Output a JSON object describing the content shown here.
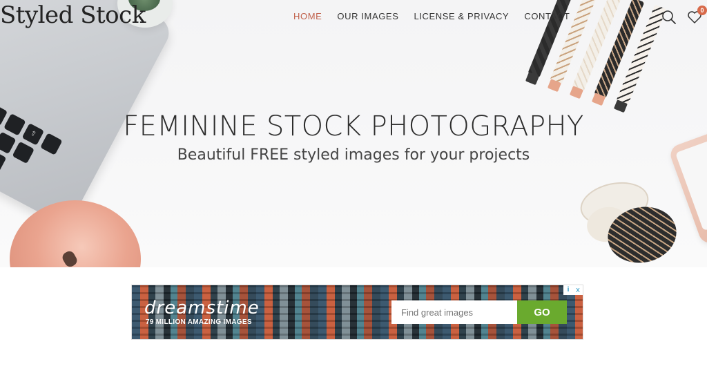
{
  "header": {
    "logo": "Styled Stock",
    "nav": [
      {
        "label": "HOME",
        "active": true
      },
      {
        "label": "OUR IMAGES",
        "active": false
      },
      {
        "label": "LICENSE & PRIVACY",
        "active": false
      },
      {
        "label": "CONTACT",
        "active": false
      }
    ],
    "search_icon": "search-icon",
    "wishlist_icon": "heart-icon",
    "wishlist_count": "0"
  },
  "hero": {
    "title": "FEMININE STOCK PHOTOGRAPHY",
    "subtitle": "Beautiful FREE styled images for your projects"
  },
  "ad": {
    "brand": "dreamstime",
    "tagline": "79 MILLION AMAZING IMAGES",
    "search_placeholder": "Find great images",
    "button_label": "GO",
    "info_icon": "i",
    "close_icon": "x"
  },
  "colors": {
    "accent": "#c0604a",
    "badge": "#d86a4a",
    "ad_go": "#6aaa2e"
  }
}
